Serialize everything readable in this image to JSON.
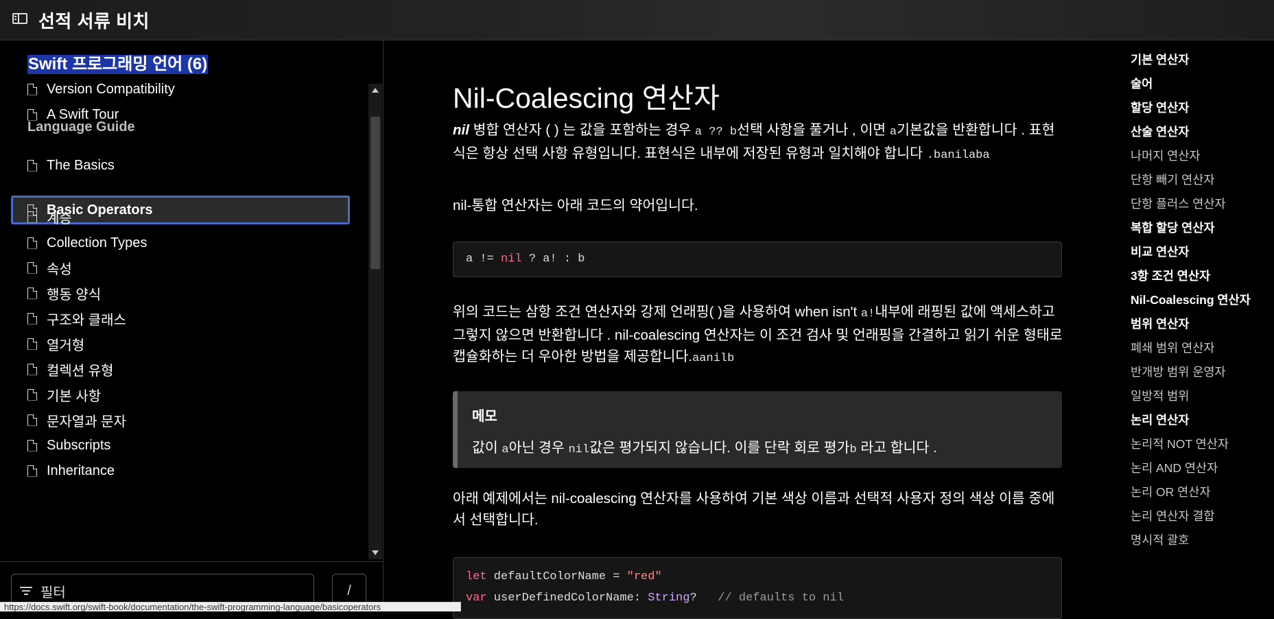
{
  "header": {
    "title": "선적 서류 비치",
    "icon": "sidebar-toggle-icon"
  },
  "sidebar": {
    "book_title": "Swift 프로그래밍 언어 (6)",
    "items_top": [
      {
        "label": "Version Compatibility"
      },
      {
        "label": "A Swift Tour"
      }
    ],
    "section_label": "Language Guide",
    "items": [
      {
        "label": "The Basics"
      },
      {
        "label": "Basic Operators"
      },
      {
        "label": "계승"
      },
      {
        "label": "Collection Types"
      },
      {
        "label": "속성"
      },
      {
        "label": "행동 양식"
      },
      {
        "label": "구조와 클래스"
      },
      {
        "label": "열거형"
      },
      {
        "label": "컬렉션 유형"
      },
      {
        "label": "기본 사항"
      },
      {
        "label": "문자열과 문자"
      },
      {
        "label": "Subscripts"
      },
      {
        "label": "Inheritance"
      }
    ],
    "active_item": "Basic Operators",
    "filter_placeholder": "필터",
    "filter_shortcut": "/"
  },
  "status_url": "https://docs.swift.org/swift-book/documentation/the-swift-programming-language/basicoperators",
  "main": {
    "title": "Nil-Coalescing 연산자",
    "p1": {
      "em": "nil",
      "t1": " 병합 연산자 ( ) 는 값을 포함하는 경우 ",
      "c1": "a ?? b",
      "t2": "선택 사항을 풀거나 , 이면 ",
      "c2": "a",
      "t3": "기본값을 반환합니다 . 표현식은 항상 선택 사항 유형입니다. 표현식은 내부에 저장된 유형과 일치해야 합니다 ",
      "c3": ".banilaba"
    },
    "p2": "nil-통합 연산자는 아래 코드의 약어입니다.",
    "code1": {
      "a": "a != ",
      "nil": "nil",
      "b": " ? a! : b"
    },
    "p3": {
      "t1": "위의 코드는 삼항 조건 연산자와 강제 언래핑( )을 사용하여 when isn't ",
      "c1": "a!",
      "t2": "내부에 래핑된 값에 액세스하고 그렇지 않으면 반환합니다 . nil-coalescing 연산자는 이 조건 검사 및 언래핑을 간결하고 읽기 쉬운 형태로 캡슐화하는 더 우아한 방법을 제공합니다.",
      "c2": "aanilb"
    },
    "note": {
      "title": "메모",
      "t1": "값이 ",
      "c1": "a",
      "t2": "아닌 경우 ",
      "c2": "nil",
      "t3": "값은 평가되지 않습니다. 이를 단락 회로 평가",
      "c3": "b",
      "t4": " 라고 합니다 ."
    },
    "p4": "아래 예제에서는 nil-coalescing 연산자를 사용하여 기본 색상 이름과 선택적 사용자 정의 색상 이름 중에서 선택합니다.",
    "code2": {
      "line1_kw": "let",
      "line1_rest": " defaultColorName = ",
      "line1_str": "\"red\"",
      "line2_kw": "var",
      "line2_rest": " userDefinedColorName: ",
      "line2_type": "String",
      "line2_q": "?",
      "line2_cmt": "// defaults to nil"
    }
  },
  "toc": [
    {
      "label": "기본 연산자",
      "strong": true
    },
    {
      "label": "술어",
      "strong": true
    },
    {
      "label": "할당 연산자",
      "strong": true
    },
    {
      "label": "산술 연산자",
      "strong": true
    },
    {
      "label": "나머지 연산자",
      "strong": false
    },
    {
      "label": "단항 빼기 연산자",
      "strong": false
    },
    {
      "label": "단항 플러스 연산자",
      "strong": false
    },
    {
      "label": "복합 할당 연산자",
      "strong": true
    },
    {
      "label": "비교 연산자",
      "strong": true
    },
    {
      "label": "3항 조건 연산자",
      "strong": true
    },
    {
      "label": "Nil-Coalescing 연산자",
      "strong": true
    },
    {
      "label": "범위 연산자",
      "strong": true
    },
    {
      "label": "폐쇄 범위 연산자",
      "strong": false
    },
    {
      "label": "반개방 범위 운영자",
      "strong": false
    },
    {
      "label": "일방적 범위",
      "strong": false
    },
    {
      "label": "논리 연산자",
      "strong": true
    },
    {
      "label": "논리적 NOT 연산자",
      "strong": false
    },
    {
      "label": "논리 AND 연산자",
      "strong": false
    },
    {
      "label": "논리 OR 연산자",
      "strong": false
    },
    {
      "label": "논리 연산자 결합",
      "strong": false
    },
    {
      "label": "명시적 괄호",
      "strong": false
    }
  ],
  "colors": {
    "background": "#000000",
    "selection": "#1c36a8",
    "active_border": "#4a6cc8",
    "keyword": "#ff6b8a",
    "string": "#ff8a80",
    "type": "#d5a6ff"
  }
}
